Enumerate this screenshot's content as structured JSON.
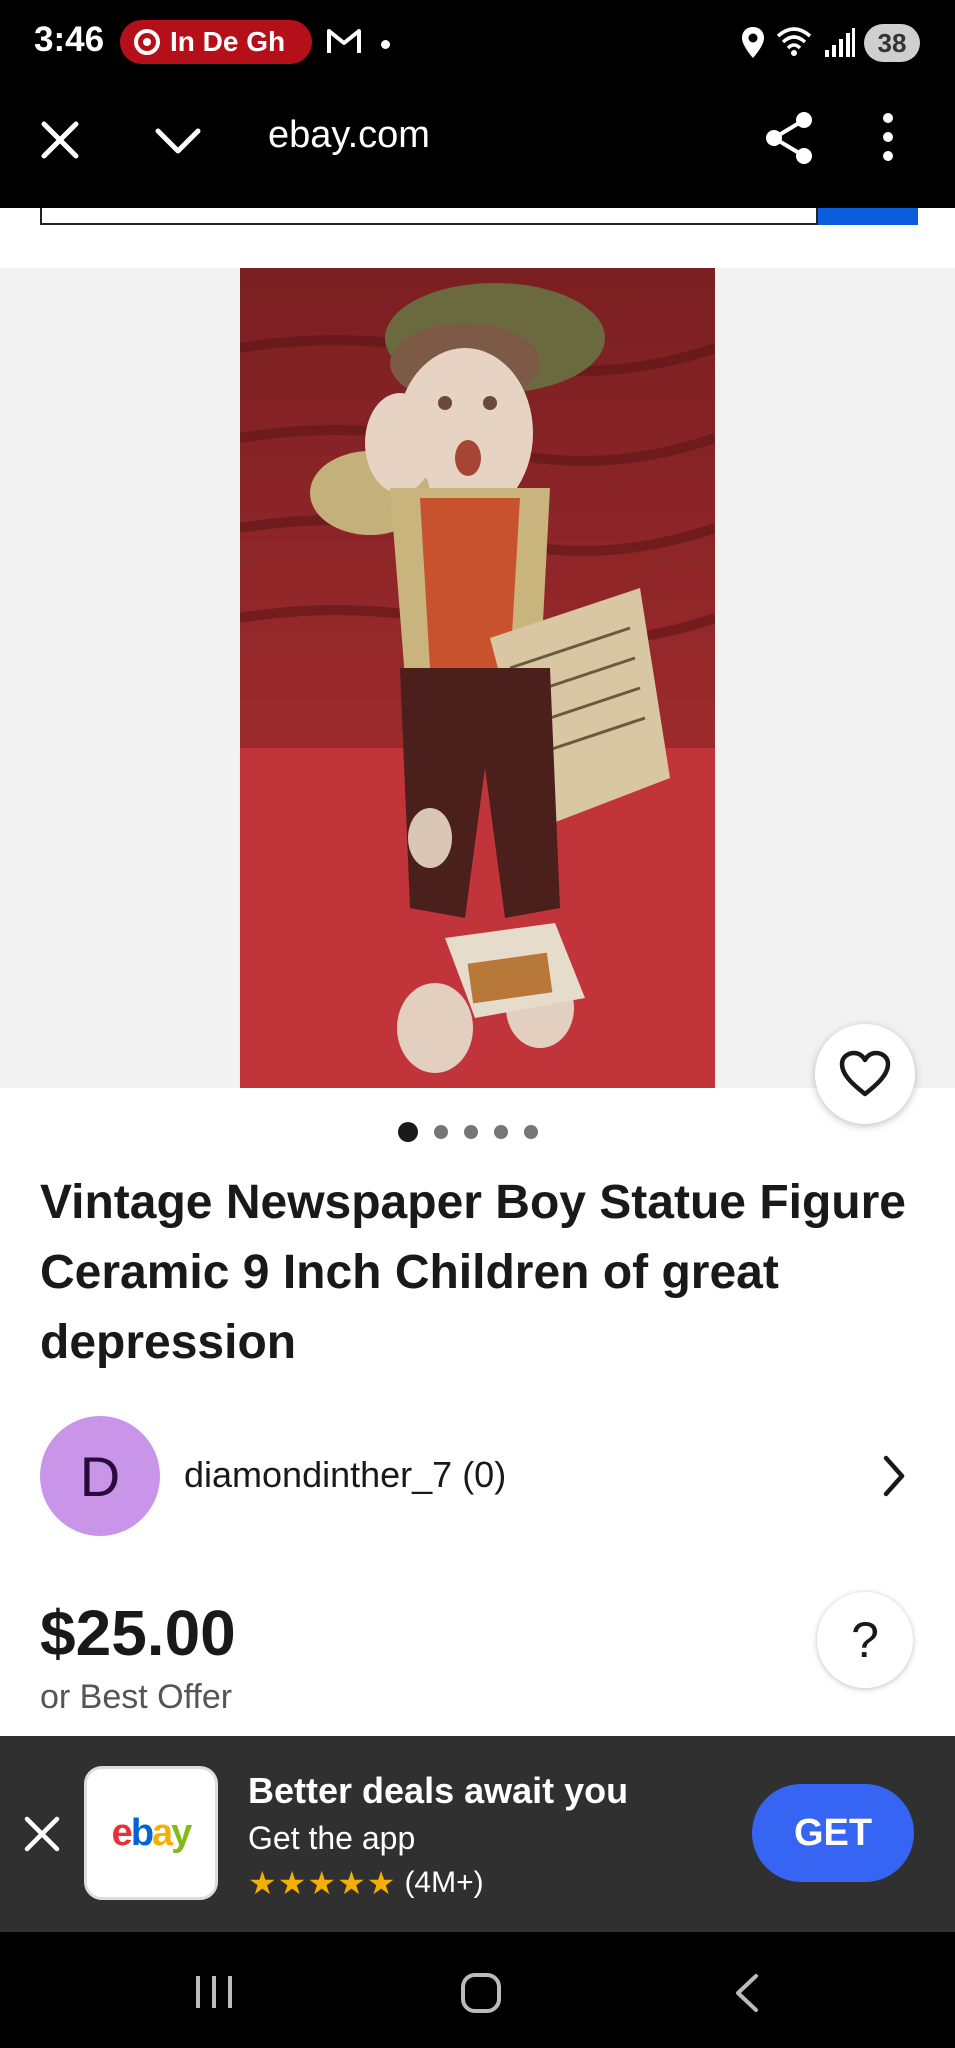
{
  "status_bar": {
    "time": "3:46",
    "notification_pill": "In De Gh",
    "battery": "38",
    "icons": [
      "target-icon",
      "gmail-icon",
      "location-icon",
      "wifi-icon",
      "signal-icon",
      "battery-icon"
    ]
  },
  "browser": {
    "url": "ebay.com",
    "icons": [
      "close-icon",
      "chevron-down-icon",
      "share-icon",
      "more-vert-icon"
    ]
  },
  "listing": {
    "title": "Vintage Newspaper Boy Statue Figure Ceramic 9 Inch Children of great depression",
    "image_count": 5,
    "active_image": 1,
    "seller": {
      "initial": "D",
      "name": "diamondinther_7 (0)"
    },
    "price": "$25.00",
    "offer_text": "or Best Offer",
    "help_label": "?"
  },
  "app_banner": {
    "logo_text": [
      "e",
      "b",
      "a",
      "y"
    ],
    "logo_colors": [
      "#e53238",
      "#0064d2",
      "#f5af02",
      "#86b817"
    ],
    "title": "Better deals await you",
    "subtitle": "Get the app",
    "stars": "★★★★★",
    "rating_count": "(4M+)",
    "cta": "GET"
  },
  "colors": {
    "accent_blue": "#3665f3",
    "avatar_purple": "#c895e8",
    "star_gold": "#f5af02"
  }
}
